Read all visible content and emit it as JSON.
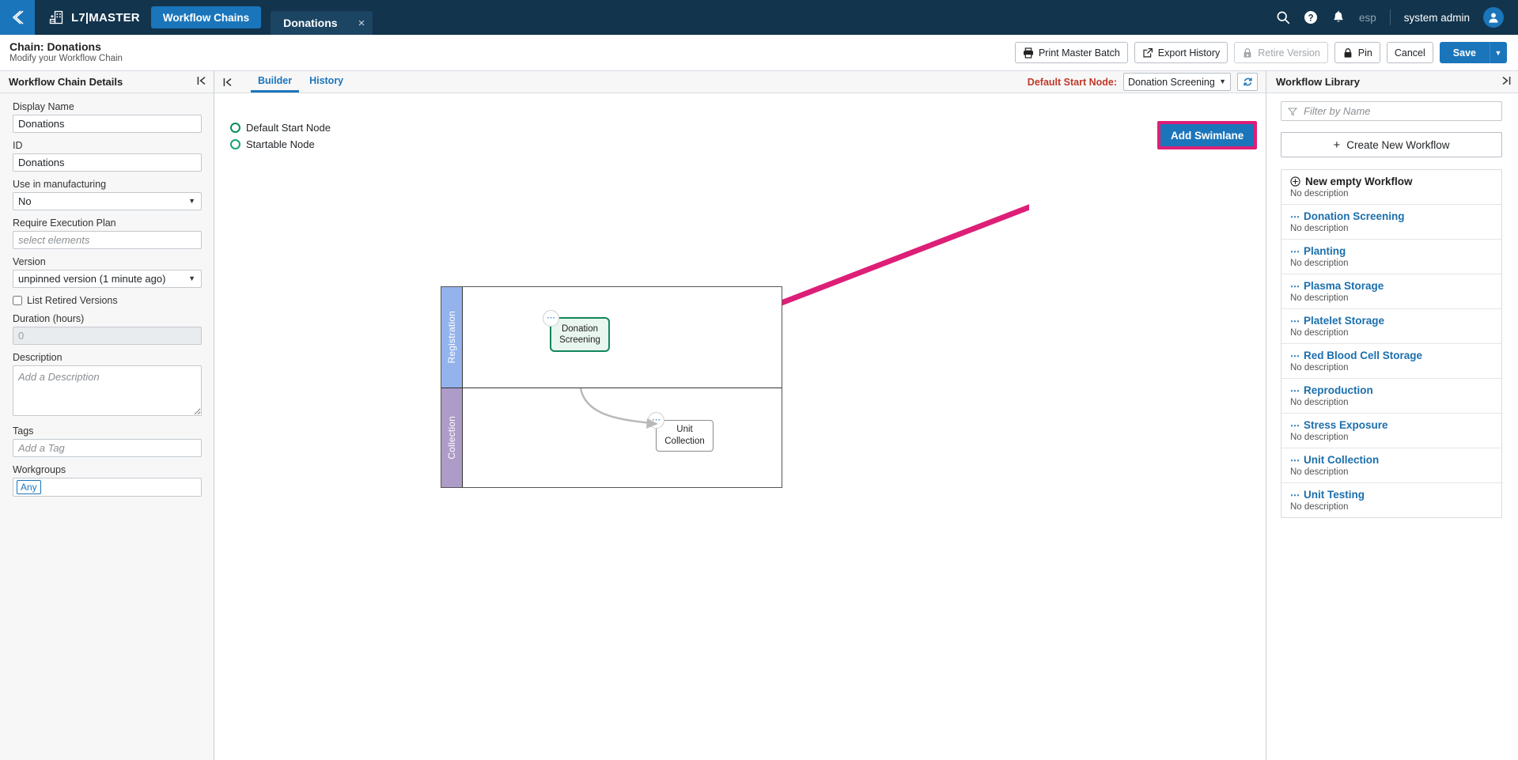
{
  "topbar": {
    "back_icon": "chevron-double-left-icon",
    "logo_icon": "building-plus-icon",
    "app_name": "L7|MASTER",
    "tab_chains": "Workflow Chains",
    "tab_document": "Donations",
    "tab_close": "×",
    "search_icon": "search-icon",
    "help_icon": "help-circle-icon",
    "bell_icon": "bell-icon",
    "language": "esp",
    "username": "system admin",
    "avatar_icon": "user-avatar-icon"
  },
  "chainbar": {
    "title": "Chain: Donations",
    "subtitle": "Modify your Workflow Chain",
    "buttons": [
      {
        "label": "Print Master Batch",
        "icon": "printer-icon",
        "disabled": false
      },
      {
        "label": "Export History",
        "icon": "external-link-icon",
        "disabled": false
      },
      {
        "label": "Retire Version",
        "icon": "lock-down-icon",
        "disabled": true
      },
      {
        "label": "Pin",
        "icon": "lock-icon",
        "disabled": false
      },
      {
        "label": "Cancel",
        "icon": "",
        "disabled": false
      }
    ],
    "save_label": "Save",
    "save_caret": "▼"
  },
  "left_panel": {
    "title": "Workflow Chain Details",
    "collapse_icon": "collapse-left-icon",
    "fields": {
      "display_name_label": "Display Name",
      "display_name_value": "Donations",
      "id_label": "ID",
      "id_value": "Donations",
      "use_in_manufacturing_label": "Use in manufacturing",
      "use_in_manufacturing_value": "No",
      "require_execution_plan_label": "Require Execution Plan",
      "require_execution_plan_placeholder": "select elements",
      "version_label": "Version",
      "version_value": "unpinned version (1 minute ago)",
      "list_retired_label": "List Retired Versions",
      "duration_label": "Duration (hours)",
      "duration_value": "0",
      "description_label": "Description",
      "description_placeholder": "Add a Description",
      "tags_label": "Tags",
      "tags_placeholder": "Add a Tag",
      "workgroups_label": "Workgroups",
      "workgroups_value": "Any"
    }
  },
  "center_panel": {
    "collapse_icon": "collapse-left-icon",
    "tabs": [
      {
        "label": "Builder",
        "active": true
      },
      {
        "label": "History",
        "active": false
      }
    ],
    "start_node_label": "Default Start Node:",
    "start_node_value": "Donation Screening",
    "refresh_icon": "refresh-icon",
    "legend": [
      {
        "label": "Default Start Node",
        "color": "#0b8f5a"
      },
      {
        "label": "Startable Node",
        "color": "#1aa179"
      }
    ],
    "add_swimlane_label": "Add Swimlane",
    "annotation": {
      "highlight_color": "#dd1f77",
      "target": "add-swimlane-button"
    },
    "diagram": {
      "lanes": [
        {
          "name": "Registration",
          "color": "#94b3ec",
          "nodes": [
            {
              "label": "Donation Screening",
              "type": "start",
              "menu_icon": "node-menu-icon"
            }
          ]
        },
        {
          "name": "Collection",
          "color": "#ad9cc8",
          "nodes": [
            {
              "label": "Unit Collection",
              "type": "plain",
              "menu_icon": "node-menu-icon"
            }
          ]
        }
      ],
      "connections": [
        {
          "from": "Donation Screening",
          "to": "Unit Collection"
        }
      ]
    }
  },
  "right_panel": {
    "title": "Workflow Library",
    "expand_icon": "expand-right-icon",
    "filter_icon": "filter-icon",
    "filter_placeholder": "Filter by Name",
    "create_label": "Create New Workflow",
    "create_icon": "plus-icon",
    "items": [
      {
        "name": "New empty Workflow",
        "description": "No description",
        "icon": "plus-circle-icon",
        "style": "black"
      },
      {
        "name": "Donation Screening",
        "description": "No description",
        "icon": "dots-icon",
        "style": "link"
      },
      {
        "name": "Planting",
        "description": "No description",
        "icon": "dots-icon",
        "style": "link"
      },
      {
        "name": "Plasma Storage",
        "description": "No description",
        "icon": "dots-icon",
        "style": "link"
      },
      {
        "name": "Platelet Storage",
        "description": "No description",
        "icon": "dots-icon",
        "style": "link"
      },
      {
        "name": "Red Blood Cell Storage",
        "description": "No description",
        "icon": "dots-icon",
        "style": "link"
      },
      {
        "name": "Reproduction",
        "description": "No description",
        "icon": "dots-icon",
        "style": "link"
      },
      {
        "name": "Stress Exposure",
        "description": "No description",
        "icon": "dots-icon",
        "style": "link"
      },
      {
        "name": "Unit Collection",
        "description": "No description",
        "icon": "dots-icon",
        "style": "link"
      },
      {
        "name": "Unit Testing",
        "description": "No description",
        "icon": "dots-icon",
        "style": "link"
      }
    ]
  },
  "colors": {
    "brand_dark": "#12344d",
    "brand_blue": "#1b75bb",
    "annotation_pink": "#dd1f77",
    "node_green": "#12875b",
    "lane_registration": "#94b3ec",
    "lane_collection": "#ad9cc8",
    "start_node_label_red": "#c0392b"
  }
}
